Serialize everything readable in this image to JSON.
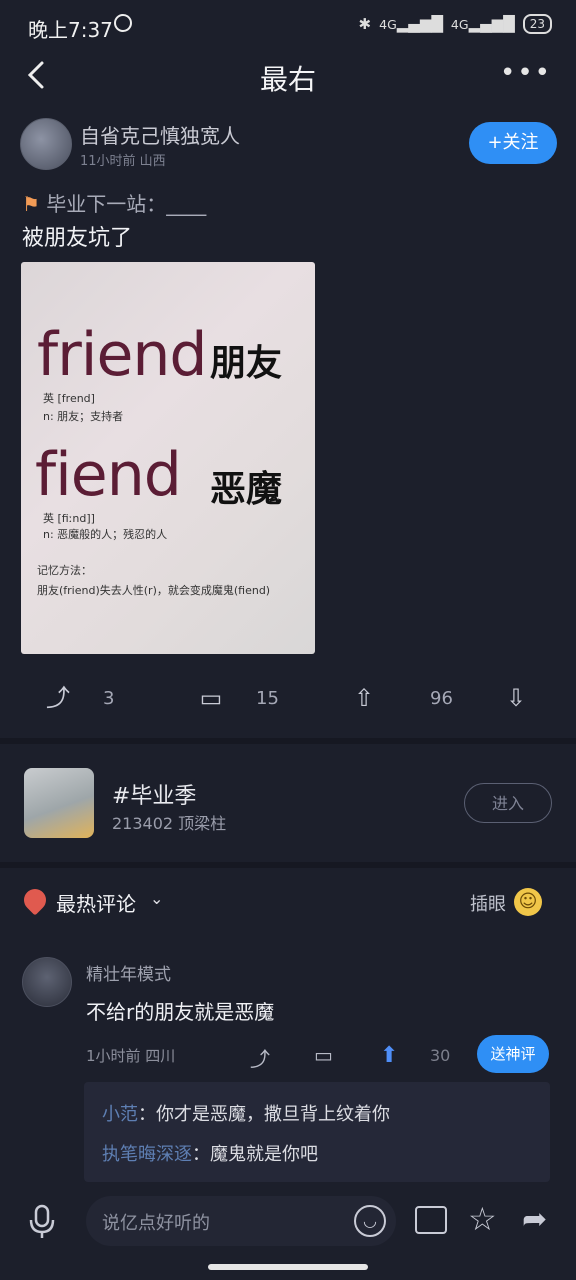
{
  "status_bar": {
    "time": "晚上7:37",
    "network": "4G",
    "battery": "23"
  },
  "nav": {
    "title": "最右"
  },
  "post": {
    "author": {
      "name": "自省克己慎独宽人",
      "meta": "11小时前  山西"
    },
    "follow_label": "+关注",
    "topic_tag": "毕业下一站：____",
    "text": "被朋友坑了",
    "image_text": {
      "word1": "friend",
      "cn1": "朋友",
      "pron1": "英 [frend]",
      "def1": "n: 朋友；支持者",
      "word2": "fiend",
      "cn2": "恶魔",
      "pron2": "英 [fiːnd]]",
      "def2": "n: 恶魔般的人；残忍的人",
      "mnemonic_title": "记忆方法：",
      "mnemonic": "朋友(friend)失去人性(r)，就会变成魔鬼(fiend)"
    },
    "actions": {
      "shares": "3",
      "comments": "15",
      "likes": "96"
    }
  },
  "topic": {
    "name": "#毕业季",
    "stats": "213402 顶梁柱",
    "enter_label": "进入"
  },
  "hot_comments": {
    "title": "最热评论",
    "butt_in_label": "插眼",
    "comment": {
      "author": "精壮年模式",
      "text": "不给r的朋友就是恶魔",
      "meta": "1小时前  四川",
      "likes": "30",
      "reward_label": "送神评"
    },
    "replies": [
      {
        "name": "小范",
        "text": "：你才是恶魔，撒旦背上纹着你"
      },
      {
        "name": "执笔晦深逐",
        "text": "：魔鬼就是你吧"
      }
    ]
  },
  "bottom_bar": {
    "input_placeholder": "说亿点好听的"
  }
}
